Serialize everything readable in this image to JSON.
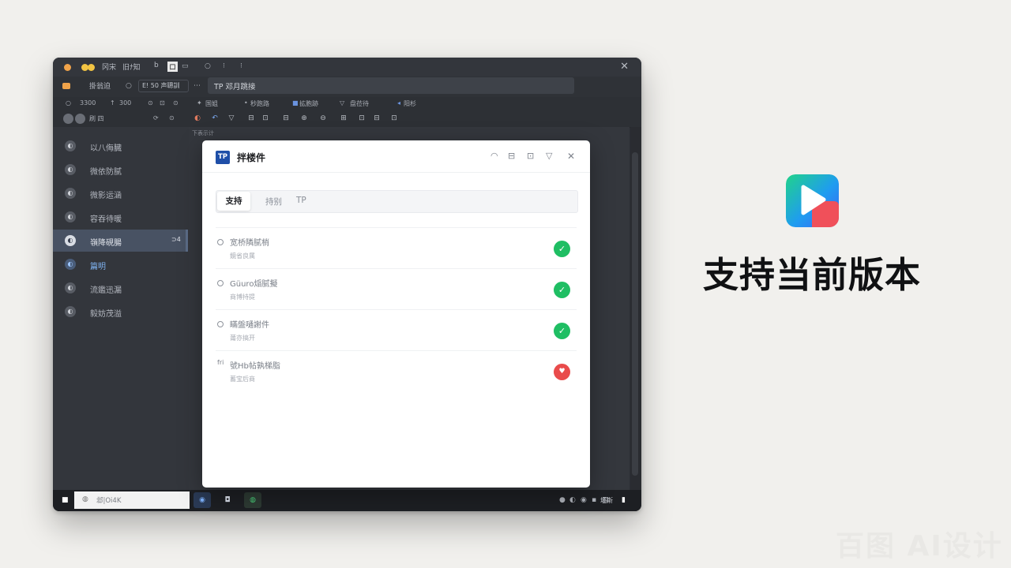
{
  "window": {
    "title_items": [
      "冈宋",
      "旧ﾅ知",
      "b",
      "ロ"
    ],
    "addr_left": [
      "掛翁迫",
      "E! 50 声聰訓"
    ],
    "address": "TP 邓月跳接",
    "toolbar_items": [
      "3300",
      "300",
      "国姐",
      "秒跑路",
      "拡胞跡",
      "盘莅待",
      "阳杉"
    ],
    "pane_label": "刷 四",
    "editor_tab": "下表示计",
    "close_glyph": "✕"
  },
  "sidebar": {
    "items": [
      {
        "label": "以八侮臓",
        "icon": "◐"
      },
      {
        "label": "微依防腻",
        "icon": "◐"
      },
      {
        "label": "微影运涵",
        "icon": "◐"
      },
      {
        "label": "容吞待暖",
        "icon": "◐"
      },
      {
        "label": "嶺降硯腸",
        "icon": "◐",
        "badge": "⊃4"
      },
      {
        "label": "篇明",
        "icon": "◐"
      },
      {
        "label": "流鑑迅漏",
        "icon": "◐"
      },
      {
        "label": "毅妨茂溢",
        "icon": "◐"
      }
    ]
  },
  "taskbar": {
    "search_text": "邶|Oi4K",
    "right_text": "坯斯"
  },
  "dialog": {
    "logo": "TP",
    "title": "拌楼件",
    "controls": [
      "◠",
      "⊟",
      "⊡",
      "▽",
      "✕"
    ],
    "tabs": {
      "active": "支持",
      "others": [
        "持别",
        "TP"
      ]
    },
    "rows": [
      {
        "title": "宽桥隣腻梢",
        "sub": "鏡省良属",
        "status": "✓",
        "status_type": "ok"
      },
      {
        "title": "Güuro㷔腻擬",
        "sub": "商博持提",
        "status": "✓",
        "status_type": "ok"
      },
      {
        "title": "瞞盤嗵謝件",
        "sub": "莆亦搞开",
        "status": "✓",
        "status_type": "ok"
      },
      {
        "title": "號Hb帖孰梯脂",
        "sub": "蓄宝后商",
        "status": "♥",
        "status_type": "bad"
      }
    ]
  },
  "promo": {
    "headline": "支持当前版本",
    "watermark": "百图 AI设计",
    "logo_name": "play-logo-icon"
  },
  "colors": {
    "ok": "#1fbe63",
    "bad": "#e94b4b",
    "accent": "#1f4fa8"
  }
}
